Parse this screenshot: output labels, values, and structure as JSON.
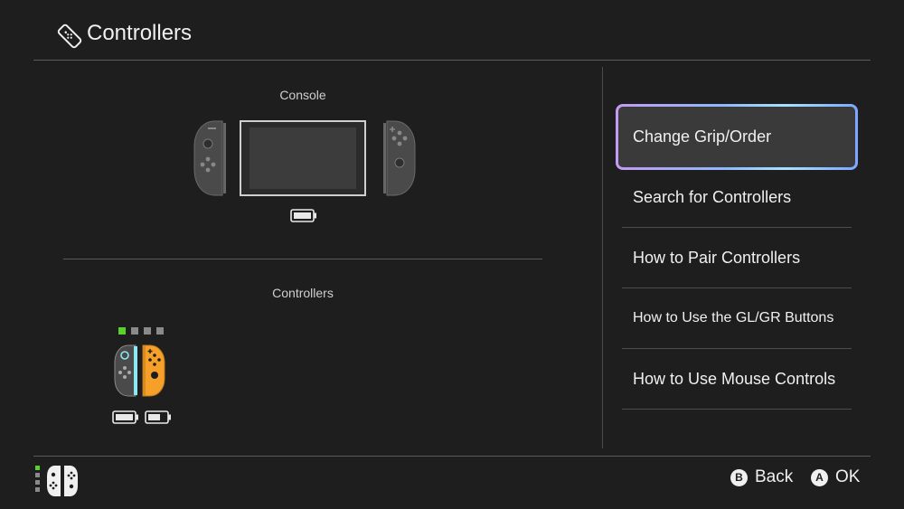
{
  "header": {
    "title": "Controllers",
    "icon": "joycon-icon"
  },
  "console_section": {
    "label": "Console",
    "battery_icon": "battery-full-icon"
  },
  "controllers_section": {
    "label": "Controllers",
    "player_indicators": 4,
    "active_player": 1,
    "left_joycon_color": "#8ee8f4",
    "right_joycon_color": "#f6a02a"
  },
  "menu": {
    "items": [
      {
        "label": "Change Grip/Order",
        "selected": true
      },
      {
        "label": "Search for Controllers"
      },
      {
        "label": "How to Pair Controllers"
      },
      {
        "label": "How to Use the GL/GR Buttons"
      },
      {
        "label": "How to Use Mouse Controls"
      }
    ]
  },
  "footer": {
    "back": {
      "glyph": "B",
      "label": "Back"
    },
    "ok": {
      "glyph": "A",
      "label": "OK"
    }
  },
  "colors": {
    "background": "#1e1e1e",
    "accent_green": "#58d22a",
    "selection_gradient": "#8fb8ff"
  }
}
